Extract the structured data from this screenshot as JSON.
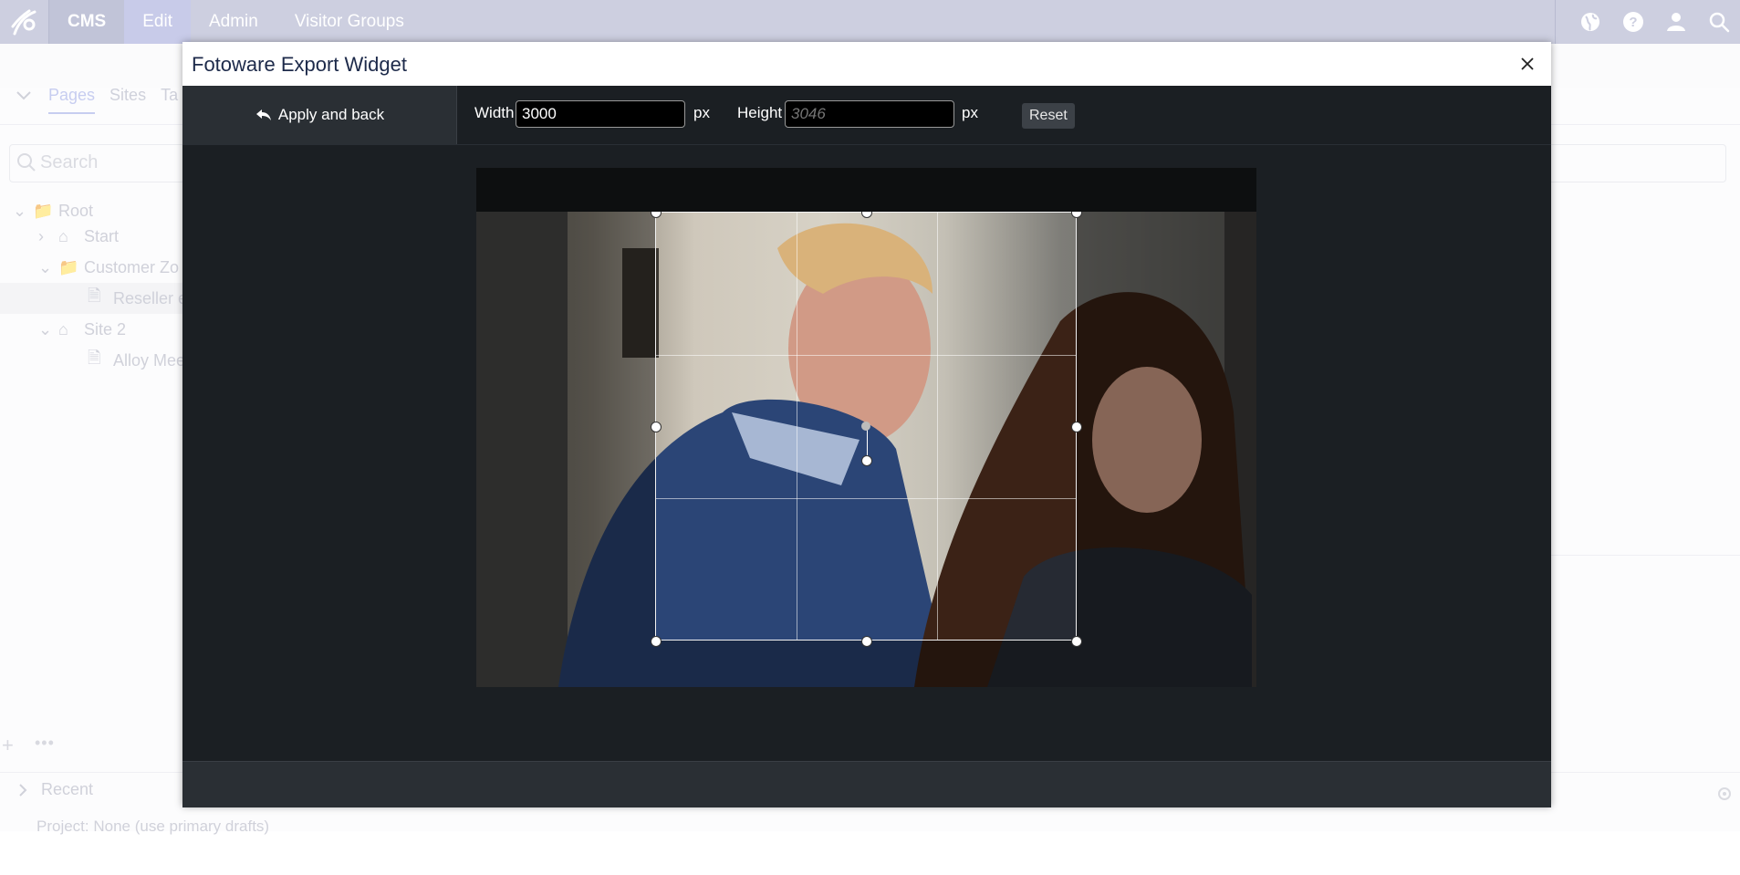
{
  "topnav": {
    "tabs": [
      {
        "label": "CMS"
      },
      {
        "label": "Edit"
      },
      {
        "label": "Admin"
      },
      {
        "label": "Visitor Groups"
      }
    ],
    "icons": [
      "globe-icon",
      "help-icon",
      "user-icon",
      "search-icon"
    ]
  },
  "background": {
    "tabs": [
      "Pages",
      "Sites",
      "Ta"
    ],
    "search_placeholder": "Search",
    "tree": [
      {
        "label": "Root"
      },
      {
        "label": "Start"
      },
      {
        "label": "Customer Zo"
      },
      {
        "label": "Reseller e"
      },
      {
        "label": "Site 2"
      },
      {
        "label": "Alloy Mee"
      }
    ],
    "recent_label": "Recent",
    "project_label": "Project:  None (use primary drafts)"
  },
  "dialog": {
    "title": "Fotoware Export Widget",
    "apply_label": "Apply and back",
    "width_label": "Width",
    "width_value": "3000",
    "width_unit": "px",
    "height_label": "Height",
    "height_placeholder": "3046",
    "height_unit": "px",
    "reset_label": "Reset"
  },
  "colors": {
    "nav_bg": "#cdcfe0",
    "dialog_bg": "#1b1f23",
    "toolbar_button_bg": "#2a2f34",
    "input_bg": "#000000"
  }
}
